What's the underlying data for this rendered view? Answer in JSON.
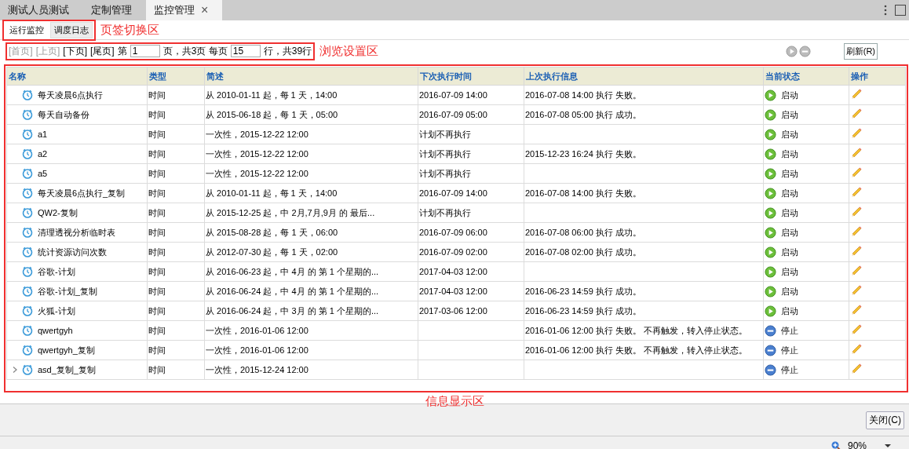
{
  "tabs": [
    {
      "label": "测试人员测试",
      "selected": false,
      "closable": false
    },
    {
      "label": "定制管理",
      "selected": false,
      "closable": false
    },
    {
      "label": "监控管理",
      "selected": true,
      "closable": true
    }
  ],
  "close_tab_glyph": "×",
  "subtabs": [
    {
      "label": "运行监控",
      "selected": true
    },
    {
      "label": "调度日志",
      "selected": false
    }
  ],
  "annotations": {
    "subtabs": "页签切换区",
    "pager": "浏览设置区",
    "table": "信息显示区"
  },
  "pager": {
    "links": [
      {
        "label": "[首页]",
        "disabled": true
      },
      {
        "label": "[上页]",
        "disabled": true
      },
      {
        "label": "[下页]",
        "disabled": false
      },
      {
        "label": "[尾页]",
        "disabled": false
      }
    ],
    "page_prefix": "第",
    "page_value": "1",
    "page_suffix": "页，共3页 每页",
    "rows_value": "15",
    "rows_suffix": "行，共39行"
  },
  "refresh_button": "刷新(R)",
  "table": {
    "columns": [
      "名称",
      "类型",
      "简述",
      "下次执行时间",
      "上次执行信息",
      "当前状态",
      "操作"
    ],
    "rows": [
      {
        "name": "每天凌晨6点执行",
        "type": "时间",
        "summary": "从 2010-01-11 起，每 1 天，14:00",
        "next": "2016-07-09 14:00",
        "last": "2016-07-08 14:00 执行 失败。",
        "kind": "running",
        "status": "启动",
        "expandable": false
      },
      {
        "name": "每天自动备份",
        "type": "时间",
        "summary": "从 2015-06-18 起，每 1 天，05:00",
        "next": "2016-07-09 05:00",
        "last": "2016-07-08 05:00 执行 成功。",
        "kind": "running",
        "status": "启动",
        "expandable": false
      },
      {
        "name": "a1",
        "type": "时间",
        "summary": "一次性，2015-12-22 12:00",
        "next": "计划不再执行",
        "last": "",
        "kind": "running",
        "status": "启动",
        "expandable": false
      },
      {
        "name": "a2",
        "type": "时间",
        "summary": "一次性，2015-12-22 12:00",
        "next": "计划不再执行",
        "last": "2015-12-23 16:24 执行 失败。",
        "kind": "running",
        "status": "启动",
        "expandable": false
      },
      {
        "name": "a5",
        "type": "时间",
        "summary": "一次性，2015-12-22 12:00",
        "next": "计划不再执行",
        "last": "",
        "kind": "running",
        "status": "启动",
        "expandable": false
      },
      {
        "name": "每天凌晨6点执行_复制",
        "type": "时间",
        "summary": "从 2010-01-11 起，每 1 天，14:00",
        "next": "2016-07-09 14:00",
        "last": "2016-07-08 14:00 执行 失败。",
        "kind": "running",
        "status": "启动",
        "expandable": false
      },
      {
        "name": "QW2-复制",
        "type": "时间",
        "summary": "从 2015-12-25 起，中 2月,7月,9月 的 最后...",
        "next": "计划不再执行",
        "last": "",
        "kind": "running",
        "status": "启动",
        "expandable": false
      },
      {
        "name": "清理透视分析临时表",
        "type": "时间",
        "summary": "从 2015-08-28 起，每 1 天，06:00",
        "next": "2016-07-09 06:00",
        "last": "2016-07-08 06:00 执行 成功。",
        "kind": "running",
        "status": "启动",
        "expandable": false
      },
      {
        "name": "统计资源访问次数",
        "type": "时间",
        "summary": "从 2012-07-30 起，每 1 天，02:00",
        "next": "2016-07-09 02:00",
        "last": "2016-07-08 02:00 执行 成功。",
        "kind": "running",
        "status": "启动",
        "expandable": false
      },
      {
        "name": "谷歌-计划",
        "type": "时间",
        "summary": "从 2016-06-23 起，中 4月 的 第 1 个星期的...",
        "next": "2017-04-03 12:00",
        "last": "",
        "kind": "running",
        "status": "启动",
        "expandable": false
      },
      {
        "name": "谷歌-计划_复制",
        "type": "时间",
        "summary": "从 2016-06-24 起，中 4月 的 第 1 个星期的...",
        "next": "2017-04-03 12:00",
        "last": "2016-06-23 14:59 执行 成功。",
        "kind": "running",
        "status": "启动",
        "expandable": false
      },
      {
        "name": "火狐-计划",
        "type": "时间",
        "summary": "从 2016-06-24 起，中 3月 的 第 1 个星期的...",
        "next": "2017-03-06 12:00",
        "last": "2016-06-23 14:59 执行 成功。",
        "kind": "running",
        "status": "启动",
        "expandable": false
      },
      {
        "name": "qwertgyh",
        "type": "时间",
        "summary": "一次性，2016-01-06 12:00",
        "next": "",
        "last": "2016-01-06 12:00 执行 失败。 不再触发，转入停止状态。",
        "kind": "stopped",
        "status": "停止",
        "expandable": false
      },
      {
        "name": "qwertgyh_复制",
        "type": "时间",
        "summary": "一次性，2016-01-06 12:00",
        "next": "",
        "last": "2016-01-06 12:00 执行 失败。 不再触发，转入停止状态。",
        "kind": "stopped",
        "status": "停止",
        "expandable": false
      },
      {
        "name": "asd_复制_复制",
        "type": "时间",
        "summary": "一次性，2015-12-24 12:00",
        "next": "",
        "last": "",
        "kind": "stopped",
        "status": "停止",
        "expandable": true
      }
    ]
  },
  "close_button": "关闭(C)",
  "status_bar": {
    "zoom": "90%"
  }
}
